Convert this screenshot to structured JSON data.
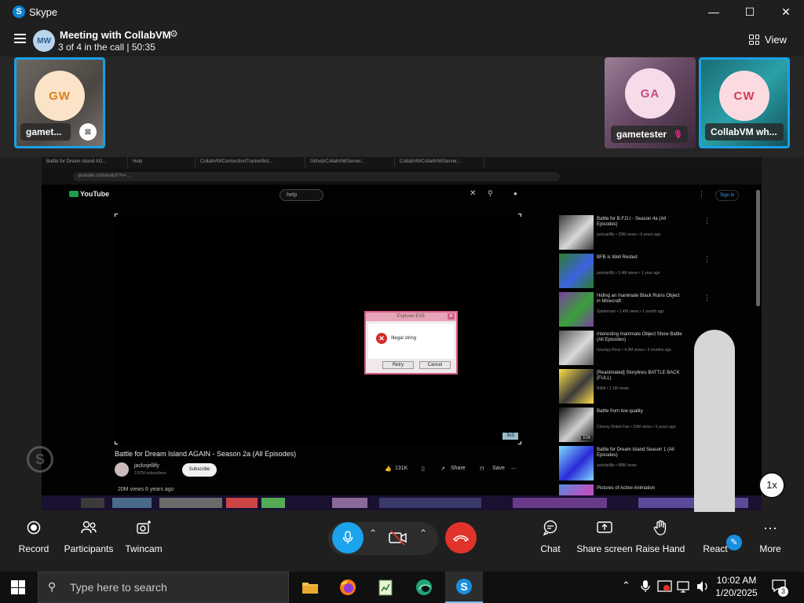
{
  "window": {
    "app_name": "Skype",
    "minimize": "—",
    "maximize": "☐",
    "close": "✕"
  },
  "meeting": {
    "avatar_initials": "MW",
    "title": "Meeting with CollabVM",
    "subtitle": "3 of 4 in the call | 50:35",
    "view_label": "View"
  },
  "participants": [
    {
      "initials": "GW",
      "name": "gamet...",
      "active": true,
      "avatar_bg": "#fbe3c8",
      "avatar_fg": "#d6821f"
    },
    {
      "initials": "GA",
      "name": "gametester",
      "active": false,
      "avatar_bg": "#f6dce9",
      "avatar_fg": "#c64a88"
    },
    {
      "initials": "CW",
      "name": "CollabVM wh...",
      "active": true,
      "avatar_bg": "#fbdbe0",
      "avatar_fg": "#d43b55"
    }
  ],
  "shared_screen": {
    "browser_tabs": [
      "Battle for Dream Island AG...",
      "Help",
      "CollabVM/ConnectionTrackerBot...",
      "Github/CollabVM/Server...",
      "CollabVM/CollabVM/Server..."
    ],
    "url": "youtube.com/watch?v=...",
    "youtube": {
      "logo": "YouTube",
      "search_value": "help",
      "signin": "Sign in",
      "video_title": "Battle for Dream Island AGAIN - Season 2a (All Episodes)",
      "channel": "jacknjellify",
      "channel_subs": "2.87M subscribers",
      "subscribe": "Subscribe",
      "likes": "131K",
      "share": "Share",
      "save": "Save",
      "views": "20M views  6 years ago",
      "video_badge": "3x3"
    },
    "error_dialog": {
      "title": "Explorer.EXE",
      "message": "Illegal string",
      "retry": "Retry",
      "cancel": "Cancel"
    },
    "sidebar": [
      {
        "title": "Battle for B.F.D.I - Season 4a (All Episodes)",
        "meta": "jacknjellify • 20M views • 6 years ago",
        "duration": "",
        "colors": [
          "#3a3a3a",
          "#d9d9d9"
        ]
      },
      {
        "title": "BFB is Well Rested",
        "meta": "jacknjellify • 3.4M views • 1 year ago",
        "duration": "",
        "colors": [
          "#2b7c2b",
          "#3f62e0"
        ]
      },
      {
        "title": "Hiding an Inanimate Black Ruins Object in Minecraft",
        "meta": "Spiderman • 1.4M views • 1 month ago",
        "duration": "",
        "colors": [
          "#7a3fa0",
          "#3aa23a"
        ]
      },
      {
        "title": "Interesting Inanimate Object Show Battle (All Episodes)",
        "meta": "Grumpy Rock • 4.3M views • 3 months ago",
        "duration": "",
        "colors": [
          "#5a5a5a",
          "#d9d9d9"
        ]
      },
      {
        "title": "[Reanimated] Storylines BATTLE BACK (FULL)",
        "meta": "Bdfdi • 2.1M views",
        "duration": "",
        "colors": [
          "#ffe14a",
          "#3b3b3b"
        ]
      },
      {
        "title": "Battle from low quality",
        "meta": "Cheesy Robot Fan • 10M views • 3 years ago",
        "duration": "3:24",
        "colors": [
          "#111111",
          "#d0d0d0"
        ]
      },
      {
        "title": "Battle for Dream Island Season 1 (All Episodes)",
        "meta": "jacknjellify • 88M views",
        "duration": "",
        "colors": [
          "#7fd9ff",
          "#2a2ad6"
        ]
      },
      {
        "title": "Pictures of Active Animation",
        "meta": "",
        "duration": "",
        "colors": [
          "#5a8ae0",
          "#c050c0"
        ]
      }
    ]
  },
  "call_controls": {
    "record": "Record",
    "participants": "Participants",
    "twincam": "Twincam",
    "chat": "Chat",
    "share_screen": "Share screen",
    "raise_hand": "Raise Hand",
    "react": "React",
    "more": "More",
    "playback_speed": "1x"
  },
  "taskbar": {
    "search_placeholder": "Type here to search",
    "time": "10:02 AM",
    "date": "1/20/2025",
    "notification_count": "3"
  }
}
